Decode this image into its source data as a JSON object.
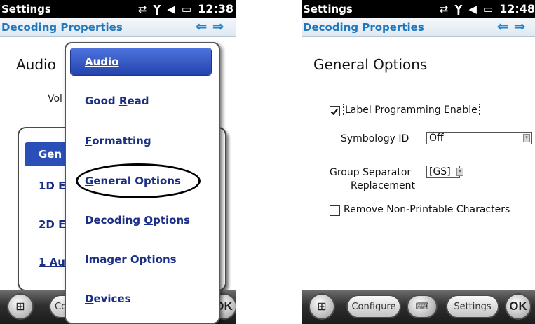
{
  "left": {
    "status_title": "Settings",
    "status_time": "12:38",
    "subtitle": "Decoding Properties",
    "heading_partial": "Audio",
    "volume_partial": "Vol",
    "panel_items": [
      "Gen",
      "1D E",
      "2D E",
      "1 Au"
    ],
    "menu": {
      "items": [
        {
          "pre": "",
          "u": "Audio",
          "post": ""
        },
        {
          "pre": "Good ",
          "u": "R",
          "post": "ead"
        },
        {
          "pre": "",
          "u": "F",
          "post": "ormatting"
        },
        {
          "pre": "",
          "u": "G",
          "post": "eneral Options"
        },
        {
          "pre": "Decoding ",
          "u": "O",
          "post": "ptions"
        },
        {
          "pre": "",
          "u": "I",
          "post": "mager Options"
        },
        {
          "pre": "",
          "u": "D",
          "post": "evices"
        }
      ],
      "selected": "Audio",
      "circled": "General Options"
    },
    "taskbar": {
      "configure_partial": "Co",
      "ok": "OK"
    }
  },
  "right": {
    "status_title": "Settings",
    "status_time": "12:48",
    "subtitle": "Decoding Properties",
    "heading": "General Options",
    "label_programming": {
      "label": "Label Programming Enable",
      "checked": true
    },
    "symbology_id": {
      "label": "Symbology ID",
      "value": "Off"
    },
    "group_separator": {
      "label_line1": "Group Separator",
      "label_line2": "Replacement",
      "value": "[GS]"
    },
    "remove_non_printable": {
      "label": "Remove Non-Printable Characters",
      "checked": false
    },
    "taskbar": {
      "configure": "Configure",
      "settings": "Settings",
      "ok": "OK"
    }
  },
  "colors": {
    "accent": "#1f78bd",
    "menu_text": "#1c2f86",
    "selected_bg": "#2a4fb9"
  }
}
